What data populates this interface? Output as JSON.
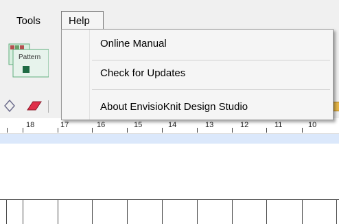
{
  "menubar": {
    "tools_label": "Tools",
    "help_label": "Help"
  },
  "help_menu": {
    "items": [
      {
        "label": "Online Manual"
      },
      {
        "label": "Check for Updates"
      },
      {
        "label": "About EnvisioKnit Design Studio"
      }
    ]
  },
  "toolbar": {
    "pattern_icon_label": "Pattern",
    "icon_name": "pattern-icon"
  },
  "ruler": {
    "numbers": [
      "18",
      "17",
      "16",
      "15",
      "14",
      "13",
      "12",
      "11",
      "10"
    ]
  },
  "colors": {
    "menu_bg": "#f0f0f0",
    "dropdown_bg": "#f5f5f5",
    "highlight_band": "#dbe8fb",
    "pattern_icon_green": "#5fae7d"
  }
}
